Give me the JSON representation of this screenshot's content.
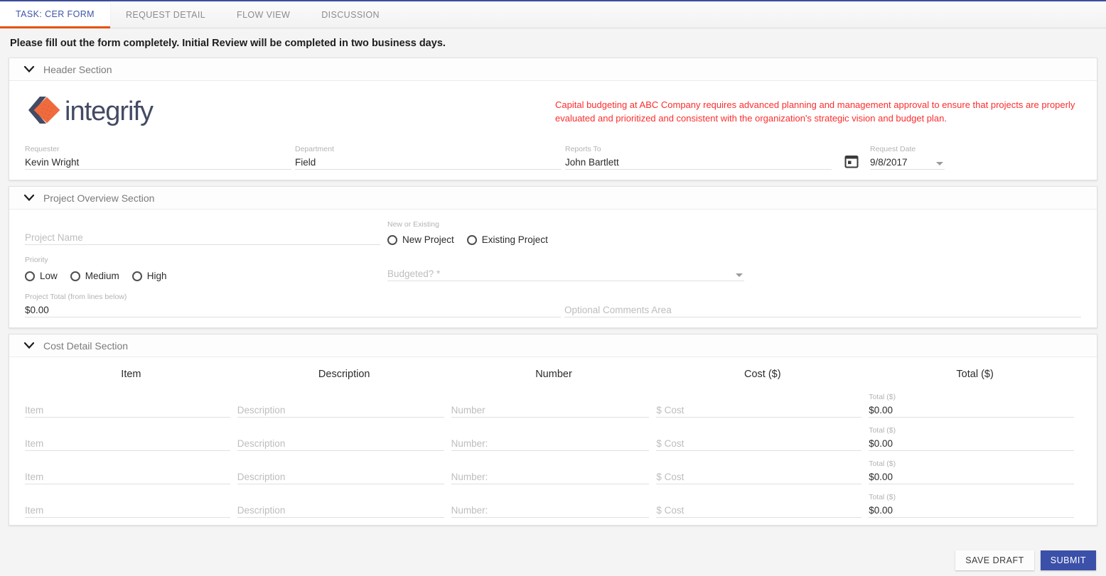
{
  "tabs": [
    {
      "label": "TASK: CER FORM",
      "active": true
    },
    {
      "label": "REQUEST DETAIL",
      "active": false
    },
    {
      "label": "FLOW VIEW",
      "active": false
    },
    {
      "label": "DISCUSSION",
      "active": false
    }
  ],
  "instruction": "Please fill out the form completely. Initial Review will be completed in two business days.",
  "header_section": {
    "title": "Header Section",
    "logo_text": "integrify",
    "notice": "Capital budgeting at ABC Company requires advanced planning and management approval to ensure that projects are properly evaluated and prioritized and consistent with the organization's strategic vision and budget plan.",
    "fields": {
      "requester": {
        "label": "Requester",
        "value": "Kevin Wright"
      },
      "department": {
        "label": "Department",
        "value": "Field"
      },
      "reports_to": {
        "label": "Reports To",
        "value": "John Bartlett"
      },
      "request_date": {
        "label": "Request Date",
        "value": "9/8/2017"
      }
    }
  },
  "project_overview_section": {
    "title": "Project Overview Section",
    "project_name": {
      "placeholder": "Project Name",
      "value": ""
    },
    "new_or_existing": {
      "label": "New or Existing",
      "options": [
        {
          "label": "New Project",
          "selected": false
        },
        {
          "label": "Existing Project",
          "selected": false
        }
      ]
    },
    "priority": {
      "label": "Priority",
      "options": [
        {
          "label": "Low",
          "selected": false
        },
        {
          "label": "Medium",
          "selected": false
        },
        {
          "label": "High",
          "selected": false
        }
      ]
    },
    "budgeted": {
      "placeholder": "Budgeted? *",
      "value": ""
    },
    "project_total": {
      "label": "Project Total (from lines below)",
      "value": "$0.00"
    },
    "comments": {
      "placeholder": "Optional Comments Area",
      "value": ""
    }
  },
  "cost_detail_section": {
    "title": "Cost Detail Section",
    "columns": [
      "Item",
      "Description",
      "Number",
      "Cost ($)",
      "Total ($)"
    ],
    "rows": [
      {
        "item": "Item",
        "description": "Description",
        "number": "Number",
        "cost": "$ Cost",
        "total_label": "Total ($)",
        "total_value": "$0.00"
      },
      {
        "item": "Item",
        "description": "Description",
        "number": "Number:",
        "cost": "$ Cost",
        "total_label": "Total ($)",
        "total_value": "$0.00"
      },
      {
        "item": "Item",
        "description": "Description",
        "number": "Number:",
        "cost": "$ Cost",
        "total_label": "Total ($)",
        "total_value": "$0.00"
      },
      {
        "item": "Item",
        "description": "Description",
        "number": "Number:",
        "cost": "$ Cost",
        "total_label": "Total ($)",
        "total_value": "$0.00"
      }
    ]
  },
  "footer": {
    "save_draft": "SAVE DRAFT",
    "submit": "SUBMIT"
  },
  "colors": {
    "accent_blue": "#4055a8",
    "tab_underline_orange": "#e2540d",
    "notice_red": "#fc2d2d",
    "submit_blue": "#3b50a8",
    "logo_orange": "#ef6a3d",
    "logo_navy": "#434a63"
  }
}
